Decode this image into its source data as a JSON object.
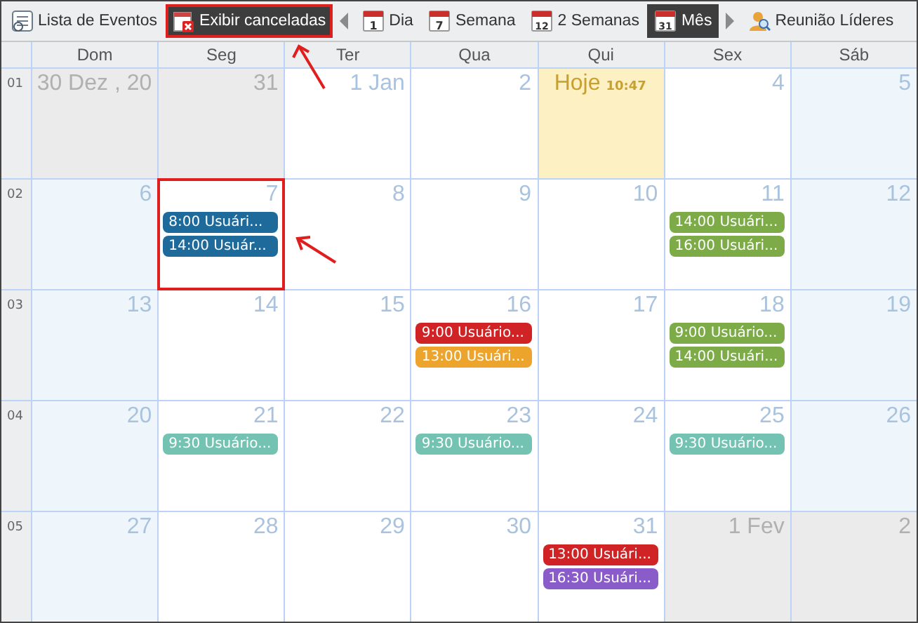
{
  "toolbar": [
    {
      "kind": "list",
      "label": "Lista de Eventos",
      "selected": false,
      "highlighted": false
    },
    {
      "kind": "cancel",
      "label": "Exibir canceladas",
      "selected": true,
      "highlighted": true
    },
    {
      "kind": "prev"
    },
    {
      "kind": "view",
      "label": "Dia",
      "icon_text": "1",
      "selected": false,
      "highlighted": false
    },
    {
      "kind": "view",
      "label": "Semana",
      "icon_text": "7",
      "selected": false,
      "highlighted": false
    },
    {
      "kind": "view",
      "label": "2 Semanas",
      "icon_text": "12",
      "selected": false,
      "highlighted": false
    },
    {
      "kind": "view",
      "label": "Mês",
      "icon_text": "31",
      "selected": true,
      "highlighted": false
    },
    {
      "kind": "next"
    },
    {
      "kind": "user",
      "label": "Reunião Líderes",
      "selected": false,
      "highlighted": false
    }
  ],
  "weekdays": [
    "Dom",
    "Seg",
    "Ter",
    "Qua",
    "Qui",
    "Sex",
    "Sáb"
  ],
  "weeks": [
    {
      "number": "01",
      "days": [
        {
          "date": "30 Dez , 20",
          "kind": "other",
          "highlighted": false
        },
        {
          "date": "31",
          "kind": "other",
          "highlighted": false
        },
        {
          "date": "1 Jan",
          "kind": "normal",
          "highlighted": false
        },
        {
          "date": "2",
          "kind": "normal",
          "highlighted": false
        },
        {
          "date": "Hoje",
          "time": "10:47",
          "kind": "today",
          "highlighted": false
        },
        {
          "date": "4",
          "kind": "normal",
          "highlighted": false
        },
        {
          "date": "5",
          "kind": "weekend",
          "highlighted": false
        }
      ]
    },
    {
      "number": "02",
      "days": [
        {
          "date": "6",
          "kind": "weekend",
          "highlighted": false
        },
        {
          "date": "7",
          "kind": "normal",
          "highlighted": true,
          "events": [
            {
              "text": "8:00 Usuári...",
              "color": "#1e6a9b"
            },
            {
              "text": "14:00 Usuár...",
              "color": "#1e6a9b"
            }
          ]
        },
        {
          "date": "8",
          "kind": "normal",
          "highlighted": false
        },
        {
          "date": "9",
          "kind": "normal",
          "highlighted": false
        },
        {
          "date": "10",
          "kind": "normal",
          "highlighted": false
        },
        {
          "date": "11",
          "kind": "normal",
          "highlighted": false,
          "events": [
            {
              "text": "14:00 Usuári...",
              "color": "#7cab47"
            },
            {
              "text": "16:00 Usuári...",
              "color": "#7cab47"
            }
          ]
        },
        {
          "date": "12",
          "kind": "weekend",
          "highlighted": false
        }
      ]
    },
    {
      "number": "03",
      "days": [
        {
          "date": "13",
          "kind": "weekend",
          "highlighted": false
        },
        {
          "date": "14",
          "kind": "normal",
          "highlighted": false
        },
        {
          "date": "15",
          "kind": "normal",
          "highlighted": false
        },
        {
          "date": "16",
          "kind": "normal",
          "highlighted": false,
          "events": [
            {
              "text": "9:00 Usuário...",
              "color": "#d02325"
            },
            {
              "text": "13:00 Usuári...",
              "color": "#eda42d"
            }
          ]
        },
        {
          "date": "17",
          "kind": "normal",
          "highlighted": false
        },
        {
          "date": "18",
          "kind": "normal",
          "highlighted": false,
          "events": [
            {
              "text": "9:00 Usuário...",
              "color": "#7cab47"
            },
            {
              "text": "14:00 Usuári...",
              "color": "#7cab47"
            }
          ]
        },
        {
          "date": "19",
          "kind": "weekend",
          "highlighted": false
        }
      ]
    },
    {
      "number": "04",
      "days": [
        {
          "date": "20",
          "kind": "weekend",
          "highlighted": false
        },
        {
          "date": "21",
          "kind": "normal",
          "highlighted": false,
          "events": [
            {
              "text": "9:30 Usuário...",
              "color": "#74c2b2"
            }
          ]
        },
        {
          "date": "22",
          "kind": "normal",
          "highlighted": false
        },
        {
          "date": "23",
          "kind": "normal",
          "highlighted": false,
          "events": [
            {
              "text": "9:30 Usuário...",
              "color": "#74c2b2"
            }
          ]
        },
        {
          "date": "24",
          "kind": "normal",
          "highlighted": false
        },
        {
          "date": "25",
          "kind": "normal",
          "highlighted": false,
          "events": [
            {
              "text": "9:30 Usuário...",
              "color": "#74c2b2"
            }
          ]
        },
        {
          "date": "26",
          "kind": "weekend",
          "highlighted": false
        }
      ]
    },
    {
      "number": "05",
      "days": [
        {
          "date": "27",
          "kind": "weekend",
          "highlighted": false
        },
        {
          "date": "28",
          "kind": "normal",
          "highlighted": false
        },
        {
          "date": "29",
          "kind": "normal",
          "highlighted": false
        },
        {
          "date": "30",
          "kind": "normal",
          "highlighted": false
        },
        {
          "date": "31",
          "kind": "normal",
          "highlighted": false,
          "events": [
            {
              "text": "13:00 Usuári...",
              "color": "#d02325"
            },
            {
              "text": "16:30 Usuári...",
              "color": "#8a5cc9"
            }
          ]
        },
        {
          "date": "1 Fev",
          "kind": "other",
          "highlighted": false
        },
        {
          "date": "2",
          "kind": "other",
          "highlighted": false
        }
      ]
    }
  ]
}
